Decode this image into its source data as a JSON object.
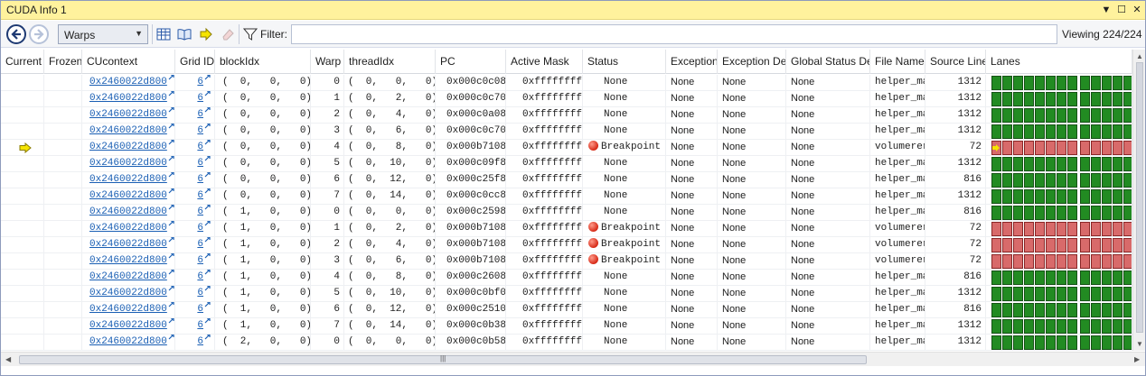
{
  "window": {
    "title": "CUDA Info 1",
    "menu_glyph": "▼",
    "maximize_glyph": "☐",
    "close_glyph": "✕"
  },
  "toolbar": {
    "view_select": "Warps",
    "filter_label": "Filter:",
    "filter_value": "",
    "viewing": "Viewing 224/224"
  },
  "columns": [
    "Current",
    "Frozen",
    "CUcontext",
    "Grid ID",
    "blockIdx",
    "Warp",
    "threadIdx",
    "PC",
    "Active Mask",
    "Status",
    "Exception",
    "Exception Det",
    "Global Status De",
    "File Name",
    "Source Line",
    "Lanes"
  ],
  "rows": [
    {
      "current": false,
      "cucontext": "0x2460022d800",
      "grid": "6",
      "block": "(  0,   0,   0)",
      "warp": "0",
      "thread": "(  0,   0,   0)",
      "pc": "0x000c0c08",
      "mask": "0xffffffff",
      "status": "None",
      "bp": false,
      "exception": "None",
      "exc_det": "None",
      "global": "None",
      "file": "helper_ma",
      "line": "1312",
      "lanes": "green",
      "first_lane_current": false
    },
    {
      "current": false,
      "cucontext": "0x2460022d800",
      "grid": "6",
      "block": "(  0,   0,   0)",
      "warp": "1",
      "thread": "(  0,   2,   0)",
      "pc": "0x000c0c70",
      "mask": "0xffffffff",
      "status": "None",
      "bp": false,
      "exception": "None",
      "exc_det": "None",
      "global": "None",
      "file": "helper_ma",
      "line": "1312",
      "lanes": "green",
      "first_lane_current": false
    },
    {
      "current": false,
      "cucontext": "0x2460022d800",
      "grid": "6",
      "block": "(  0,   0,   0)",
      "warp": "2",
      "thread": "(  0,   4,   0)",
      "pc": "0x000c0a08",
      "mask": "0xffffffff",
      "status": "None",
      "bp": false,
      "exception": "None",
      "exc_det": "None",
      "global": "None",
      "file": "helper_ma",
      "line": "1312",
      "lanes": "green",
      "first_lane_current": false
    },
    {
      "current": false,
      "cucontext": "0x2460022d800",
      "grid": "6",
      "block": "(  0,   0,   0)",
      "warp": "3",
      "thread": "(  0,   6,   0)",
      "pc": "0x000c0c70",
      "mask": "0xffffffff",
      "status": "None",
      "bp": false,
      "exception": "None",
      "exc_det": "None",
      "global": "None",
      "file": "helper_ma",
      "line": "1312",
      "lanes": "green",
      "first_lane_current": false
    },
    {
      "current": true,
      "cucontext": "0x2460022d800",
      "grid": "6",
      "block": "(  0,   0,   0)",
      "warp": "4",
      "thread": "(  0,   8,   0)",
      "pc": "0x000b7108",
      "mask": "0xffffffff",
      "status": "Breakpoint",
      "bp": true,
      "exception": "None",
      "exc_det": "None",
      "global": "None",
      "file": "volumerer",
      "line": "72",
      "lanes": "red",
      "first_lane_current": true
    },
    {
      "current": false,
      "cucontext": "0x2460022d800",
      "grid": "6",
      "block": "(  0,   0,   0)",
      "warp": "5",
      "thread": "(  0,  10,   0)",
      "pc": "0x000c09f8",
      "mask": "0xffffffff",
      "status": "None",
      "bp": false,
      "exception": "None",
      "exc_det": "None",
      "global": "None",
      "file": "helper_ma",
      "line": "1312",
      "lanes": "green",
      "first_lane_current": false
    },
    {
      "current": false,
      "cucontext": "0x2460022d800",
      "grid": "6",
      "block": "(  0,   0,   0)",
      "warp": "6",
      "thread": "(  0,  12,   0)",
      "pc": "0x000c25f8",
      "mask": "0xffffffff",
      "status": "None",
      "bp": false,
      "exception": "None",
      "exc_det": "None",
      "global": "None",
      "file": "helper_ma",
      "line": "816",
      "lanes": "green",
      "first_lane_current": false
    },
    {
      "current": false,
      "cucontext": "0x2460022d800",
      "grid": "6",
      "block": "(  0,   0,   0)",
      "warp": "7",
      "thread": "(  0,  14,   0)",
      "pc": "0x000c0cc8",
      "mask": "0xffffffff",
      "status": "None",
      "bp": false,
      "exception": "None",
      "exc_det": "None",
      "global": "None",
      "file": "helper_ma",
      "line": "1312",
      "lanes": "green",
      "first_lane_current": false
    },
    {
      "current": false,
      "cucontext": "0x2460022d800",
      "grid": "6",
      "block": "(  1,   0,   0)",
      "warp": "0",
      "thread": "(  0,   0,   0)",
      "pc": "0x000c2598",
      "mask": "0xffffffff",
      "status": "None",
      "bp": false,
      "exception": "None",
      "exc_det": "None",
      "global": "None",
      "file": "helper_ma",
      "line": "816",
      "lanes": "green",
      "first_lane_current": false
    },
    {
      "current": false,
      "cucontext": "0x2460022d800",
      "grid": "6",
      "block": "(  1,   0,   0)",
      "warp": "1",
      "thread": "(  0,   2,   0)",
      "pc": "0x000b7108",
      "mask": "0xffffffff",
      "status": "Breakpoint",
      "bp": true,
      "exception": "None",
      "exc_det": "None",
      "global": "None",
      "file": "volumerer",
      "line": "72",
      "lanes": "red",
      "first_lane_current": false
    },
    {
      "current": false,
      "cucontext": "0x2460022d800",
      "grid": "6",
      "block": "(  1,   0,   0)",
      "warp": "2",
      "thread": "(  0,   4,   0)",
      "pc": "0x000b7108",
      "mask": "0xffffffff",
      "status": "Breakpoint",
      "bp": true,
      "exception": "None",
      "exc_det": "None",
      "global": "None",
      "file": "volumerer",
      "line": "72",
      "lanes": "red",
      "first_lane_current": false
    },
    {
      "current": false,
      "cucontext": "0x2460022d800",
      "grid": "6",
      "block": "(  1,   0,   0)",
      "warp": "3",
      "thread": "(  0,   6,   0)",
      "pc": "0x000b7108",
      "mask": "0xffffffff",
      "status": "Breakpoint",
      "bp": true,
      "exception": "None",
      "exc_det": "None",
      "global": "None",
      "file": "volumerer",
      "line": "72",
      "lanes": "red",
      "first_lane_current": false
    },
    {
      "current": false,
      "cucontext": "0x2460022d800",
      "grid": "6",
      "block": "(  1,   0,   0)",
      "warp": "4",
      "thread": "(  0,   8,   0)",
      "pc": "0x000c2608",
      "mask": "0xffffffff",
      "status": "None",
      "bp": false,
      "exception": "None",
      "exc_det": "None",
      "global": "None",
      "file": "helper_ma",
      "line": "816",
      "lanes": "green",
      "first_lane_current": false
    },
    {
      "current": false,
      "cucontext": "0x2460022d800",
      "grid": "6",
      "block": "(  1,   0,   0)",
      "warp": "5",
      "thread": "(  0,  10,   0)",
      "pc": "0x000c0bf0",
      "mask": "0xffffffff",
      "status": "None",
      "bp": false,
      "exception": "None",
      "exc_det": "None",
      "global": "None",
      "file": "helper_ma",
      "line": "1312",
      "lanes": "green",
      "first_lane_current": false
    },
    {
      "current": false,
      "cucontext": "0x2460022d800",
      "grid": "6",
      "block": "(  1,   0,   0)",
      "warp": "6",
      "thread": "(  0,  12,   0)",
      "pc": "0x000c2510",
      "mask": "0xffffffff",
      "status": "None",
      "bp": false,
      "exception": "None",
      "exc_det": "None",
      "global": "None",
      "file": "helper_ma",
      "line": "816",
      "lanes": "green",
      "first_lane_current": false
    },
    {
      "current": false,
      "cucontext": "0x2460022d800",
      "grid": "6",
      "block": "(  1,   0,   0)",
      "warp": "7",
      "thread": "(  0,  14,   0)",
      "pc": "0x000c0b38",
      "mask": "0xffffffff",
      "status": "None",
      "bp": false,
      "exception": "None",
      "exc_det": "None",
      "global": "None",
      "file": "helper_ma",
      "line": "1312",
      "lanes": "green",
      "first_lane_current": false
    },
    {
      "current": false,
      "cucontext": "0x2460022d800",
      "grid": "6",
      "block": "(  2,   0,   0)",
      "warp": "0",
      "thread": "(  0,   0,   0)",
      "pc": "0x000c0b58",
      "mask": "0xffffffff",
      "status": "None",
      "bp": false,
      "exception": "None",
      "exc_det": "None",
      "global": "None",
      "file": "helper_ma",
      "line": "1312",
      "lanes": "green",
      "first_lane_current": false
    }
  ],
  "colors": {
    "titlebar": "#fff29d",
    "lane_active": "#228b22",
    "lane_breakpoint": "#d86a6a",
    "link": "#1a5fb4",
    "current_arrow": "#f5e400"
  }
}
